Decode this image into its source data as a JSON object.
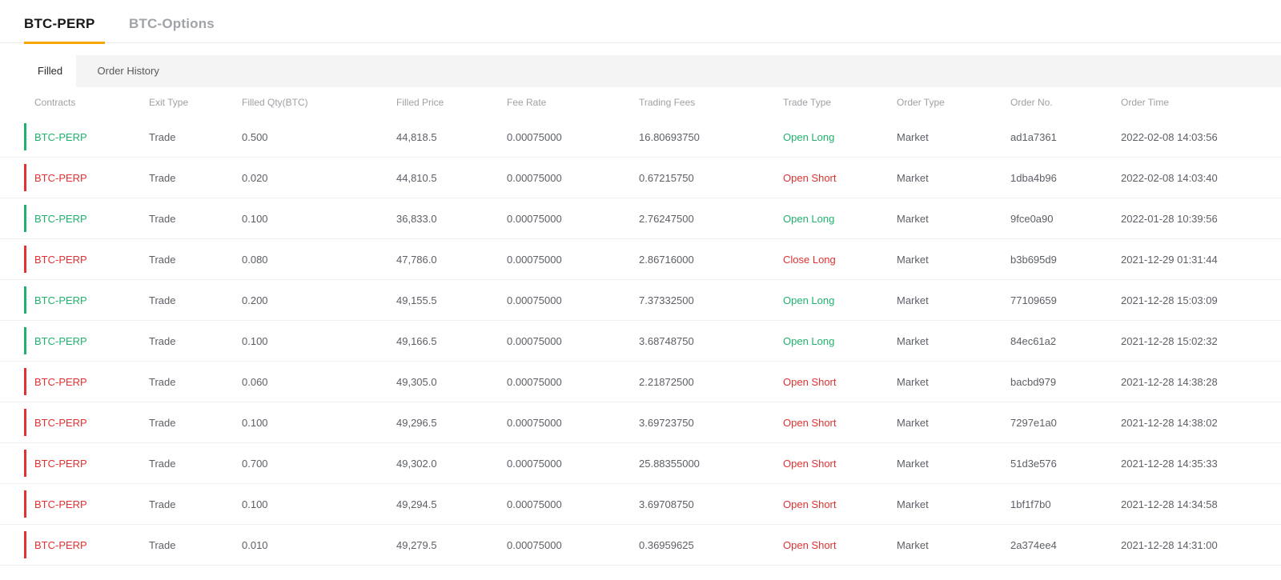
{
  "tabs": {
    "primary": [
      {
        "label": "BTC-PERP",
        "active": true
      },
      {
        "label": "BTC-Options",
        "active": false
      }
    ],
    "sub": [
      {
        "label": "Filled",
        "active": true
      },
      {
        "label": "Order History",
        "active": false
      }
    ]
  },
  "colors": {
    "accent_orange": "#f7a600",
    "long_green": "#20b26c",
    "short_red": "#e03232"
  },
  "table": {
    "columns": [
      "Contracts",
      "Exit Type",
      "Filled Qty(BTC)",
      "Filled Price",
      "Fee Rate",
      "Trading Fees",
      "Trade Type",
      "Order Type",
      "Order No.",
      "Order Time"
    ],
    "rows": [
      {
        "color": "green",
        "contracts": "BTC-PERP",
        "exit_type": "Trade",
        "filled_qty": "0.500",
        "filled_price": "44,818.5",
        "fee_rate": "0.00075000",
        "trading_fees": "16.80693750",
        "trade_type": "Open Long",
        "order_type": "Market",
        "order_no": "ad1a7361",
        "order_time": "2022-02-08 14:03:56"
      },
      {
        "color": "red",
        "contracts": "BTC-PERP",
        "exit_type": "Trade",
        "filled_qty": "0.020",
        "filled_price": "44,810.5",
        "fee_rate": "0.00075000",
        "trading_fees": "0.67215750",
        "trade_type": "Open Short",
        "order_type": "Market",
        "order_no": "1dba4b96",
        "order_time": "2022-02-08 14:03:40"
      },
      {
        "color": "green",
        "contracts": "BTC-PERP",
        "exit_type": "Trade",
        "filled_qty": "0.100",
        "filled_price": "36,833.0",
        "fee_rate": "0.00075000",
        "trading_fees": "2.76247500",
        "trade_type": "Open Long",
        "order_type": "Market",
        "order_no": "9fce0a90",
        "order_time": "2022-01-28 10:39:56"
      },
      {
        "color": "red",
        "contracts": "BTC-PERP",
        "exit_type": "Trade",
        "filled_qty": "0.080",
        "filled_price": "47,786.0",
        "fee_rate": "0.00075000",
        "trading_fees": "2.86716000",
        "trade_type": "Close Long",
        "order_type": "Market",
        "order_no": "b3b695d9",
        "order_time": "2021-12-29 01:31:44"
      },
      {
        "color": "green",
        "contracts": "BTC-PERP",
        "exit_type": "Trade",
        "filled_qty": "0.200",
        "filled_price": "49,155.5",
        "fee_rate": "0.00075000",
        "trading_fees": "7.37332500",
        "trade_type": "Open Long",
        "order_type": "Market",
        "order_no": "77109659",
        "order_time": "2021-12-28 15:03:09"
      },
      {
        "color": "green",
        "contracts": "BTC-PERP",
        "exit_type": "Trade",
        "filled_qty": "0.100",
        "filled_price": "49,166.5",
        "fee_rate": "0.00075000",
        "trading_fees": "3.68748750",
        "trade_type": "Open Long",
        "order_type": "Market",
        "order_no": "84ec61a2",
        "order_time": "2021-12-28 15:02:32"
      },
      {
        "color": "red",
        "contracts": "BTC-PERP",
        "exit_type": "Trade",
        "filled_qty": "0.060",
        "filled_price": "49,305.0",
        "fee_rate": "0.00075000",
        "trading_fees": "2.21872500",
        "trade_type": "Open Short",
        "order_type": "Market",
        "order_no": "bacbd979",
        "order_time": "2021-12-28 14:38:28"
      },
      {
        "color": "red",
        "contracts": "BTC-PERP",
        "exit_type": "Trade",
        "filled_qty": "0.100",
        "filled_price": "49,296.5",
        "fee_rate": "0.00075000",
        "trading_fees": "3.69723750",
        "trade_type": "Open Short",
        "order_type": "Market",
        "order_no": "7297e1a0",
        "order_time": "2021-12-28 14:38:02"
      },
      {
        "color": "red",
        "contracts": "BTC-PERP",
        "exit_type": "Trade",
        "filled_qty": "0.700",
        "filled_price": "49,302.0",
        "fee_rate": "0.00075000",
        "trading_fees": "25.88355000",
        "trade_type": "Open Short",
        "order_type": "Market",
        "order_no": "51d3e576",
        "order_time": "2021-12-28 14:35:33"
      },
      {
        "color": "red",
        "contracts": "BTC-PERP",
        "exit_type": "Trade",
        "filled_qty": "0.100",
        "filled_price": "49,294.5",
        "fee_rate": "0.00075000",
        "trading_fees": "3.69708750",
        "trade_type": "Open Short",
        "order_type": "Market",
        "order_no": "1bf1f7b0",
        "order_time": "2021-12-28 14:34:58"
      },
      {
        "color": "red",
        "contracts": "BTC-PERP",
        "exit_type": "Trade",
        "filled_qty": "0.010",
        "filled_price": "49,279.5",
        "fee_rate": "0.00075000",
        "trading_fees": "0.36959625",
        "trade_type": "Open Short",
        "order_type": "Market",
        "order_no": "2a374ee4",
        "order_time": "2021-12-28 14:31:00"
      }
    ]
  }
}
